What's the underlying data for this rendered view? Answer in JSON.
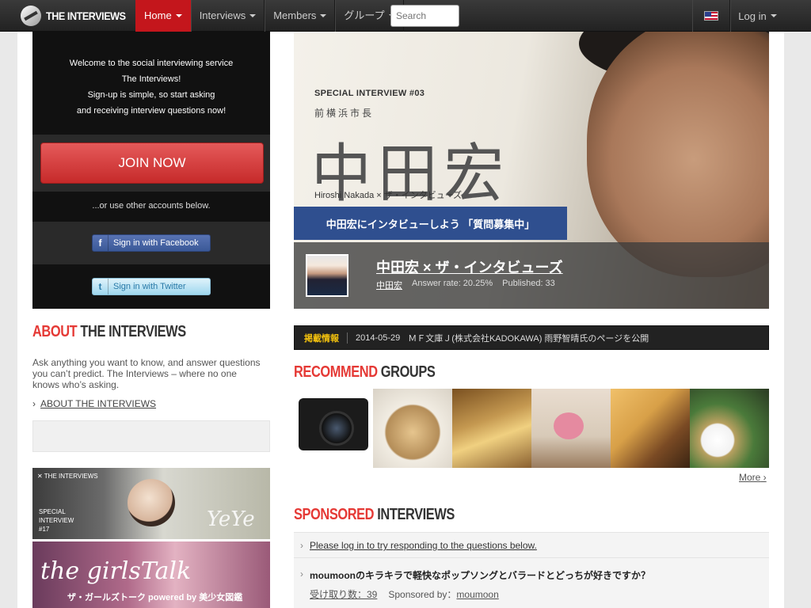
{
  "header": {
    "logo_text": "THE INTERVIEWS",
    "nav": [
      {
        "label": "Home",
        "active": true
      },
      {
        "label": "Interviews",
        "active": false
      },
      {
        "label": "Members",
        "active": false
      },
      {
        "label": "グループ",
        "active": false
      }
    ],
    "search_placeholder": "Search",
    "login_label": "Log in",
    "flag_icon": "us-flag-icon"
  },
  "signup": {
    "welcome_lines": [
      "Welcome to the social interviewing service",
      "The Interviews!",
      "Sign-up is simple, so start asking",
      "and receiving interview questions now!"
    ],
    "join_label": "JOIN NOW",
    "or_text": "...or use other accounts below.",
    "facebook_label": "Sign in with Facebook",
    "twitter_label": "Sign in with Twitter"
  },
  "about": {
    "title_accent": "ABOUT",
    "title_rest": " THE INTERVIEWS",
    "text": "Ask anything you want to know, and answer questions you can’t predict. The Interviews – where no one knows who’s asking.",
    "link_label": "ABOUT THE INTERVIEWS"
  },
  "banners": {
    "b1_tag": "✕ THE INTERVIEWS",
    "b1_special": [
      "SPECIAL",
      "INTERVIEW",
      "#17"
    ],
    "b1_name": "YeYe",
    "b2_title": "the girlsTalk",
    "b2_sub": "ザ・ガールズトーク powered by 美少女図鑑"
  },
  "hero": {
    "special_label": "SPECIAL INTERVIEW #03",
    "subtitle": "前横浜市長",
    "name": "中田宏",
    "name_en": "Hiroshi Nakada × ザ・インタビューズ",
    "cta": "中田宏にインタビューしよう 「質問募集中」",
    "bar_title": "中田宏 × ザ・インタビューズ",
    "author": "中田宏",
    "answer_rate": "Answer rate: 20.25%",
    "published": "Published: 33"
  },
  "news": {
    "tag": "掲載情報",
    "date": "2014-05-29",
    "text": "ＭＦ文庫Ｊ(株式会社KADOKAWA) 雨野智晴氏のページを公開"
  },
  "recommend": {
    "title_accent": "RECOMMEND",
    "title_rest": " GROUPS",
    "groups": [
      "camera",
      "food-bowl",
      "books",
      "bird-figure",
      "cat",
      "dinner-plate"
    ],
    "more_label": "More"
  },
  "sponsored": {
    "title_accent": "SPONSORED",
    "title_rest": " INTERVIEWS",
    "login_prompt": "Please log in to try responding to the questions below.",
    "question": "moumoonのキラキラで軽快なポップソングとバラードとどっちが好きですか？",
    "received": "受け取り数：39",
    "sponsor_label": "Sponsored by：",
    "sponsor": "moumoon"
  }
}
